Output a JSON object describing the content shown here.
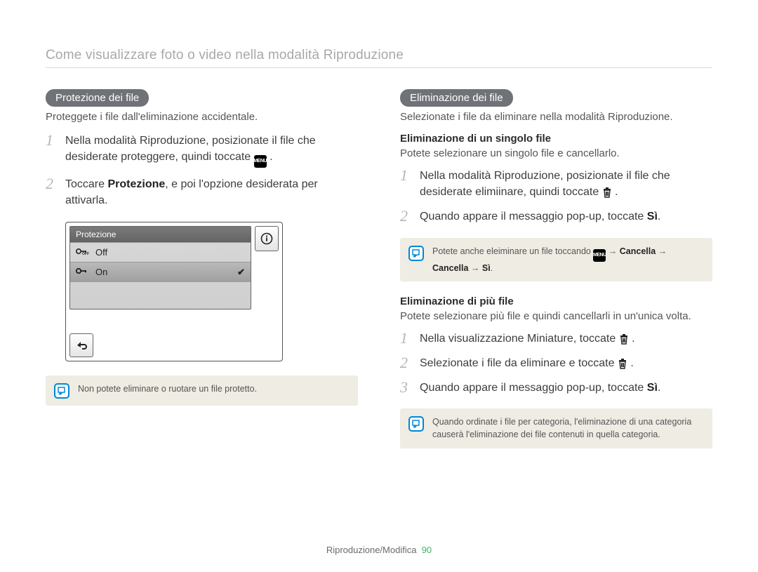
{
  "page": {
    "title": "Come visualizzare foto o video nella modalità Riproduzione",
    "footer_section": "Riproduzione/Modifica",
    "footer_page": "90"
  },
  "left": {
    "pill": "Protezione dei file",
    "intro": "Proteggete i file dall'eliminazione accidentale.",
    "step1_a": "Nella modalità Riproduzione, posizionate il file che desiderate proteggere, quindi toccate ",
    "step1_b": " .",
    "step2_a": "Toccare ",
    "step2_bold": "Protezione",
    "step2_b": ", e poi l'opzione desiderata per attivarla.",
    "screenshot": {
      "header": "Protezione",
      "off_label": "Off",
      "on_label": "On"
    },
    "note": "Non potete eliminare o ruotare un file protetto."
  },
  "right": {
    "pill": "Eliminazione dei file",
    "intro": "Selezionate i file da eliminare nella modalità Riproduzione.",
    "sub1_heading": "Eliminazione di un singolo file",
    "sub1_text": "Potete selezionare un singolo file e cancellarlo.",
    "s1_step1_a": "Nella modalità Riproduzione, posizionate il file che desiderate elimiinare, quindi toccate ",
    "s1_step1_b": " .",
    "s1_step2_a": "Quando appare il messaggio pop-up, toccate ",
    "s1_step2_bold": "Sì",
    "s1_step2_b": ".",
    "note1_a": "Potete anche eleiminare un file toccando ",
    "note1_b": " → ",
    "note1_c": "Cancella",
    "note1_d": " → ",
    "note1_e": "Cancella",
    "note1_f": " → ",
    "note1_g": "Sì",
    "note1_h": ".",
    "sub2_heading": "Eliminazione di più file",
    "sub2_text": "Potete selezionare più file e quindi cancellarli in un'unica volta.",
    "s2_step1_a": "Nella visualizzazione Miniature, toccate ",
    "s2_step1_b": " .",
    "s2_step2_a": "Selezionate i file da eliminare e toccate ",
    "s2_step2_b": " .",
    "s2_step3_a": "Quando appare il messaggio pop-up, toccate ",
    "s2_step3_bold": "Sì",
    "s2_step3_b": ".",
    "note2": "Quando ordinate i file per categoria, l'eliminazione di una categoria causerà l'eliminazione dei file contenuti in quella categoria."
  },
  "icons": {
    "menu": "MENU"
  }
}
